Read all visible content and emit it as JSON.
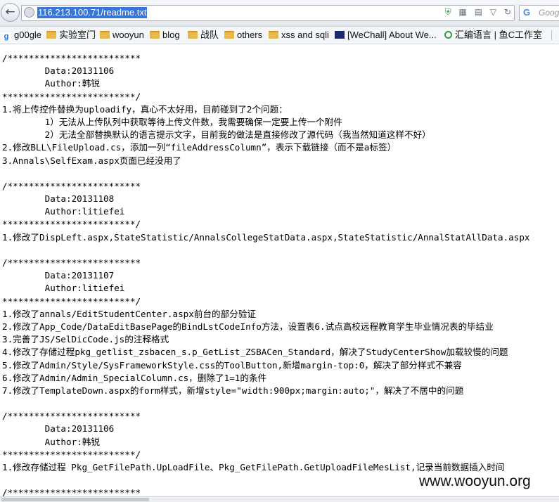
{
  "browser": {
    "url": "116.213.100.71/readme.txt",
    "search_placeholder": "Goog"
  },
  "bookmarks": [
    {
      "label": "g00gle",
      "icon": "google-icon"
    },
    {
      "label": "实验室门",
      "icon": "folder-icon"
    },
    {
      "label": "wooyun",
      "icon": "folder-icon"
    },
    {
      "label": "blog",
      "icon": "folder-icon"
    },
    {
      "label": "战队",
      "icon": "folder-icon"
    },
    {
      "label": "others",
      "icon": "folder-icon"
    },
    {
      "label": "xss and sqli",
      "icon": "folder-icon"
    },
    {
      "label": "[WeChall] About We...",
      "icon": "wechall-icon"
    },
    {
      "label": "汇编语言 | 鱼C工作室",
      "icon": "fishc-icon"
    }
  ],
  "content": {
    "lines": [
      "/*************************",
      "        Data:20131106",
      "        Author:韩锐",
      "*************************/",
      "1.将上传控件替换为uploadify，真心不太好用，目前碰到了2个问题：",
      "        1）无法从上传队列中获取等待上传文件数，我需要确保一定要上传一个附件",
      "        2）无法全部替换默认的语言提示文字，目前我的做法是直接修改了源代码（我当然知道这样不好）",
      "2.修改BLL\\FileUpload.cs，添加一列“fileAddressColumn”，表示下载链接（而不是a标签）",
      "3.Annals\\SelfExam.aspx页面已经没用了",
      "",
      "/*************************",
      "        Data:20131108",
      "        Author:litiefei",
      "*************************/",
      "1.修改了DispLeft.aspx,StateStatistic/AnnalsCollegeStatData.aspx,StateStatistic/AnnalStatAllData.aspx",
      "",
      "/*************************",
      "        Data:20131107",
      "        Author:litiefei",
      "*************************/",
      "1.修改了annals/EditStudentCenter.aspx前台的部分验证",
      "2.修改了App_Code/DataEditBasePage的BindLstCodeInfo方法，设置表6.试点高校远程教育学生毕业情况表的毕结业",
      "3.完善了JS/SelDicCode.js的注释格式",
      "4.修改了存储过程pkg_getlist_zsbacen_s.p_GetList_ZSBACen_Standard，解决了StudyCenterShow加载较慢的问题",
      "5.修改了Admin/Style/SysFrameworkStyle.css的ToolButton,新增margin-top:0，解决了部分样式不兼容",
      "6.修改了Admin/Admin_SpecialColumn.cs，删除了1=1的条件",
      "7.修改了TemplateDown.aspx的form样式，新增style=\"width:900px;margin:auto;\"，解决了不居中的问题",
      "",
      "/*************************",
      "        Data:20131106",
      "        Author:韩锐",
      "*************************/",
      "1.修改存储过程 Pkg_GetFilePath.UpLoadFile、Pkg_GetFilePath.GetUploadFileMesList,记录当前数据插入时间",
      "",
      "/*************************"
    ]
  },
  "watermark": "www.wooyun.org"
}
